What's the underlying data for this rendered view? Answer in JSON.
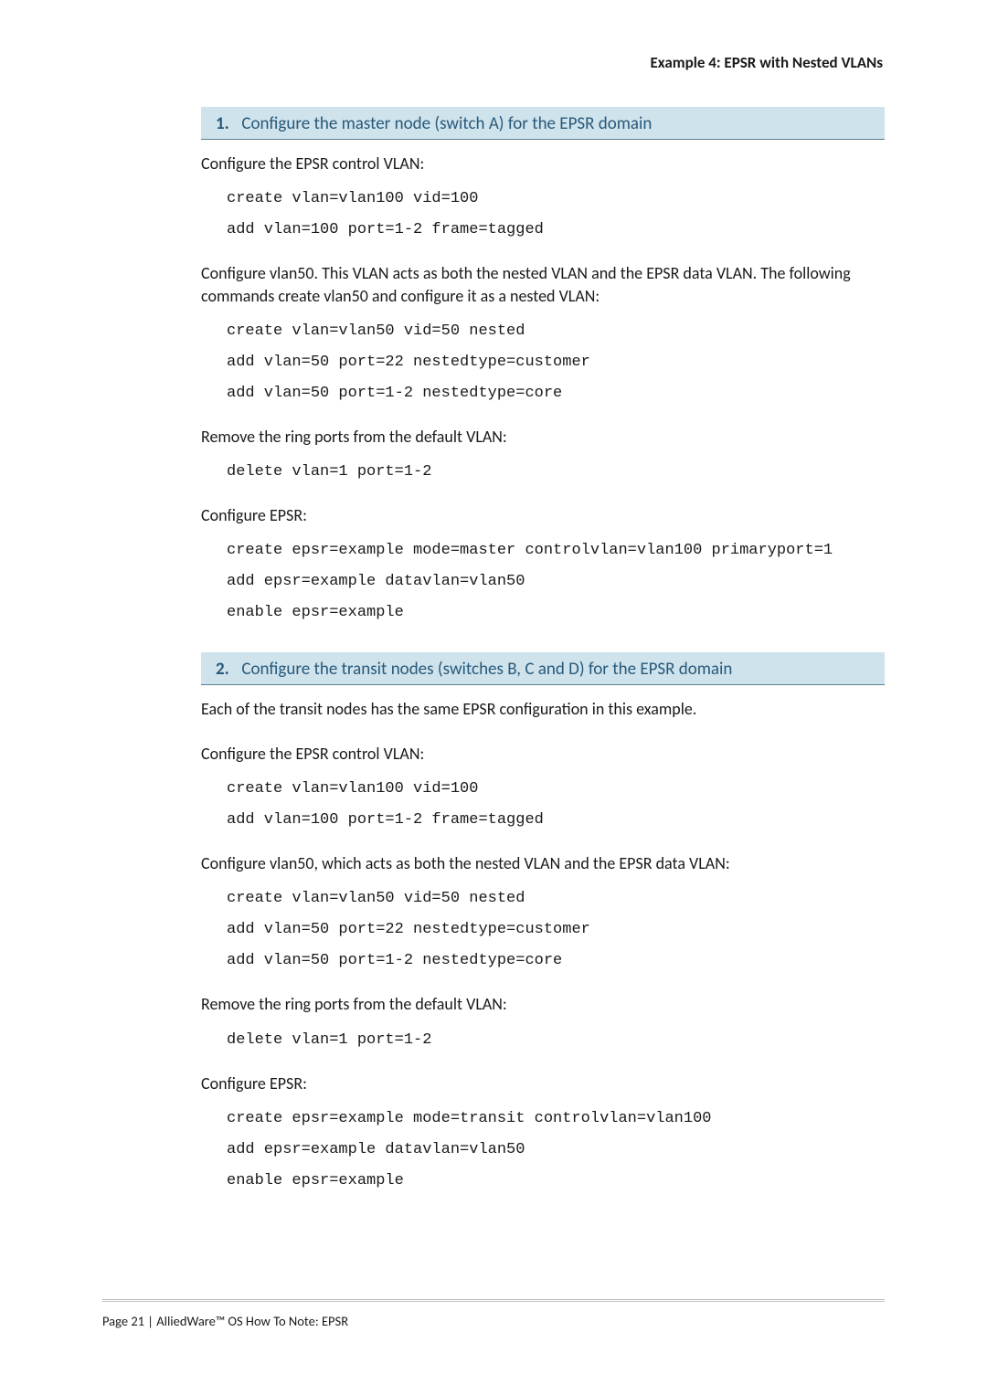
{
  "header": {
    "right": "Example 4: EPSR with Nested VLANs"
  },
  "steps": [
    {
      "num": "1.",
      "title": "Configure the master node (switch A) for the EPSR domain",
      "intro": null,
      "blocks": [
        {
          "text": "Configure the EPSR control VLAN:",
          "code": [
            "create vlan=vlan100 vid=100",
            "add vlan=100 port=1-2 frame=tagged"
          ]
        },
        {
          "text": "Configure vlan50. This VLAN acts as both the nested VLAN and the EPSR data VLAN. The following commands create vlan50 and configure it as a nested VLAN:",
          "code": [
            "create vlan=vlan50 vid=50 nested",
            "add vlan=50 port=22 nestedtype=customer",
            "add vlan=50 port=1-2 nestedtype=core"
          ]
        },
        {
          "text": "Remove the ring ports from the default VLAN:",
          "code": [
            "delete vlan=1 port=1-2"
          ]
        },
        {
          "text": "Configure EPSR:",
          "code": [
            "create epsr=example mode=master controlvlan=vlan100 primaryport=1",
            "add epsr=example datavlan=vlan50",
            "enable epsr=example"
          ]
        }
      ]
    },
    {
      "num": "2.",
      "title": "Configure the transit nodes (switches B, C and D) for the EPSR domain",
      "intro": "Each of the transit nodes has the same EPSR configuration in this example.",
      "blocks": [
        {
          "text": "Configure the EPSR control VLAN:",
          "code": [
            "create vlan=vlan100 vid=100",
            "add vlan=100 port=1-2 frame=tagged"
          ]
        },
        {
          "text": "Configure vlan50, which acts as both the nested VLAN and the EPSR data VLAN:",
          "code": [
            "create vlan=vlan50 vid=50 nested",
            "add vlan=50 port=22 nestedtype=customer",
            "add vlan=50 port=1-2 nestedtype=core"
          ]
        },
        {
          "text": "Remove the ring ports from the default VLAN:",
          "code": [
            "delete vlan=1 port=1-2"
          ]
        },
        {
          "text": "Configure EPSR:",
          "code": [
            "create epsr=example mode=transit controlvlan=vlan100",
            "add epsr=example datavlan=vlan50",
            "enable epsr=example"
          ]
        }
      ]
    }
  ],
  "footer": {
    "text": "Page 21 | AlliedWare™ OS How To Note: EPSR"
  }
}
